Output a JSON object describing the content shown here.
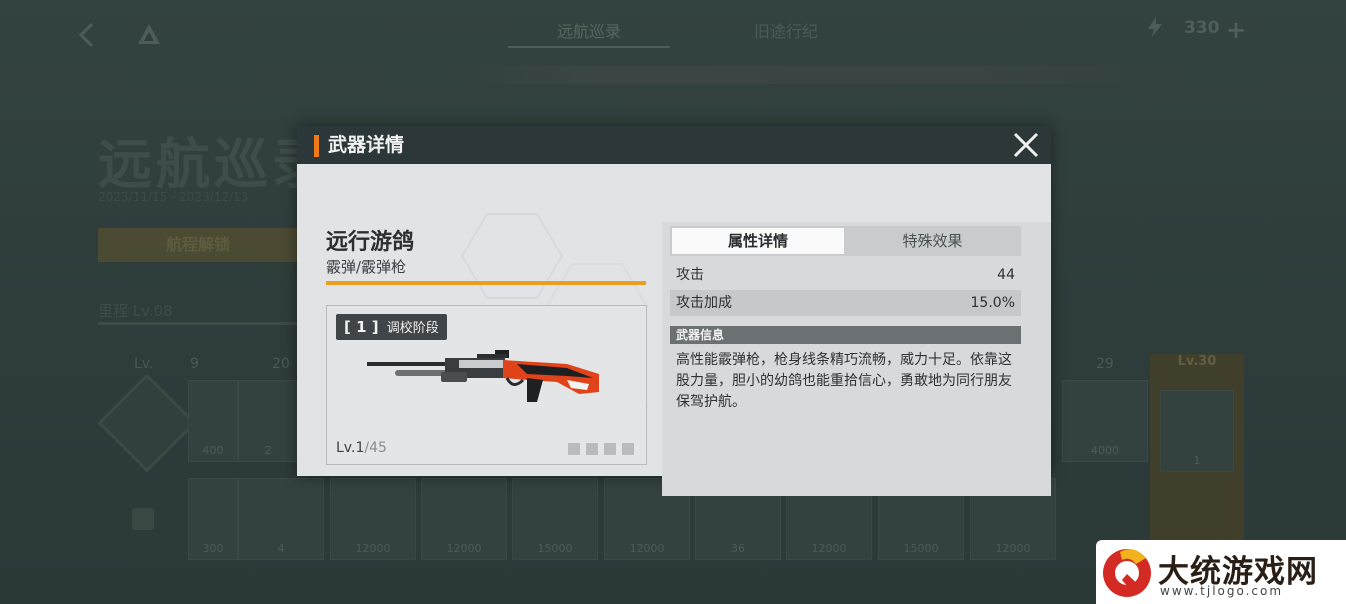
{
  "background": {
    "tabs": [
      "远航巡录",
      "旧途行纪"
    ],
    "energy": "330",
    "event_title": "远航巡录",
    "event_subtitle": "2023/11/15 - 2023/12/13",
    "claim_button": "航程解锁",
    "level_label": "里程 Lv.08",
    "lv_header": "Lv.",
    "col_labels": [
      "9",
      "20",
      "29"
    ],
    "gold_label": "Lv.30",
    "card_values_row1": [
      "400",
      "2",
      "4000",
      "1"
    ],
    "card_values_row2": [
      "300",
      "4",
      "12000",
      "12000",
      "15000",
      "12000",
      "36",
      "12000",
      "15000",
      "12000"
    ]
  },
  "modal": {
    "title": "武器详情",
    "weapon_name": "远行游鸽",
    "weapon_type": "霰弹/霰弹枪",
    "stage_number": "[ 1 ]",
    "stage_label": "调校阶段",
    "level_current": "Lv.1",
    "level_max": "/45",
    "tabs": {
      "attributes": "属性详情",
      "special": "特殊效果"
    },
    "stats": [
      {
        "label": "攻击",
        "value": "44"
      },
      {
        "label": "攻击加成",
        "value": "15.0%"
      }
    ],
    "info_header": "武器信息",
    "info_text": "高性能霰弹枪，枪身线条精巧流畅，威力十足。依靠这股力量，胆小的幼鸽也能重拾信心，勇敢地为同行朋友保驾护航。"
  },
  "watermark": {
    "title": "大统游戏网",
    "url": "www.tjlogo.com"
  },
  "colors": {
    "accent_orange": "#f07a1a",
    "level_bar": "#e9a020",
    "header_bg": "#2c3739",
    "panel_bg": "#e2e3e5"
  }
}
